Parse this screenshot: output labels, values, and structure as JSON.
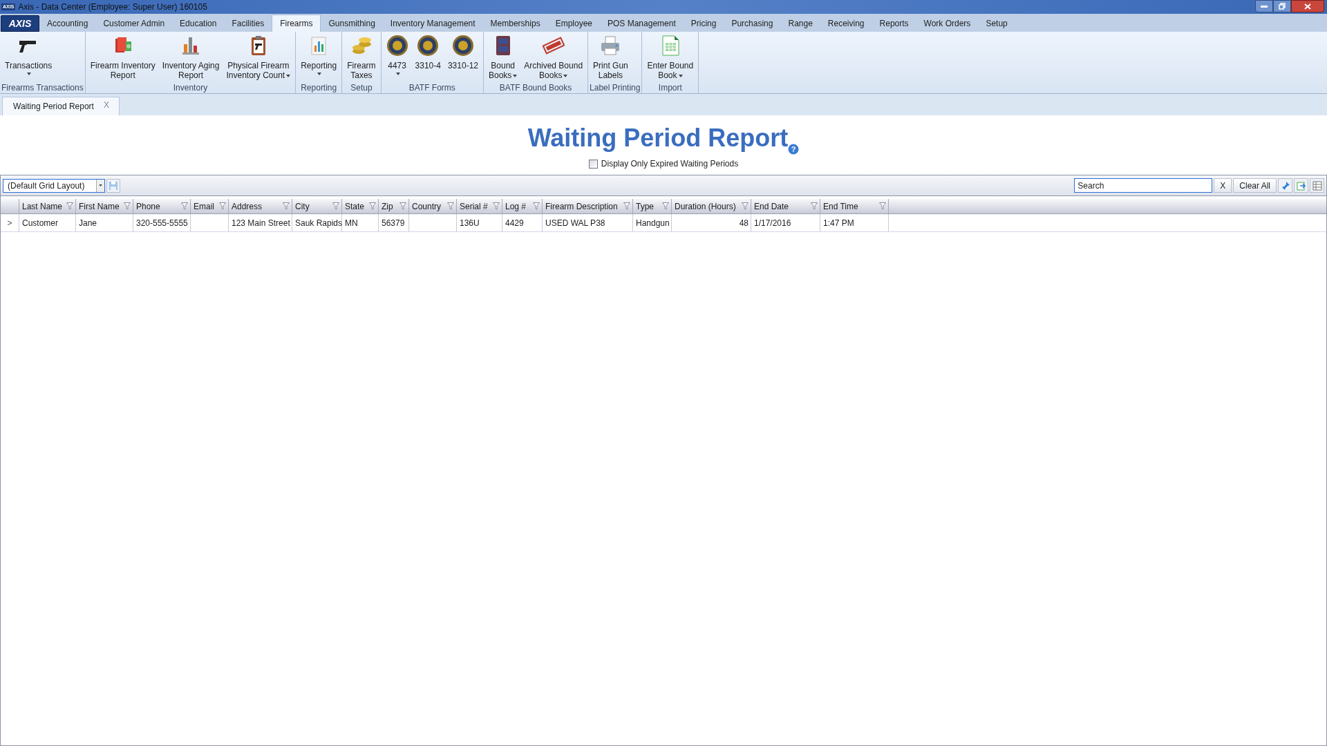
{
  "window": {
    "logo": "AXIS",
    "title": "Axis - Data Center  (Employee: Super User) 160105"
  },
  "menu_logo": "AXIS",
  "menu_tabs": [
    {
      "label": "Accounting",
      "selected": false
    },
    {
      "label": "Customer Admin",
      "selected": false
    },
    {
      "label": "Education",
      "selected": false
    },
    {
      "label": "Facilities",
      "selected": false
    },
    {
      "label": "Firearms",
      "selected": true
    },
    {
      "label": "Gunsmithing",
      "selected": false
    },
    {
      "label": "Inventory Management",
      "selected": false
    },
    {
      "label": "Memberships",
      "selected": false
    },
    {
      "label": "Employee",
      "selected": false
    },
    {
      "label": "POS Management",
      "selected": false
    },
    {
      "label": "Pricing",
      "selected": false
    },
    {
      "label": "Purchasing",
      "selected": false
    },
    {
      "label": "Range",
      "selected": false
    },
    {
      "label": "Receiving",
      "selected": false
    },
    {
      "label": "Reports",
      "selected": false
    },
    {
      "label": "Work Orders",
      "selected": false
    },
    {
      "label": "Setup",
      "selected": false
    }
  ],
  "ribbon": {
    "groups": [
      {
        "label": "Firearms Transactions",
        "items": [
          {
            "kind": "pistol",
            "lines": [
              "Transactions"
            ],
            "dropdown": true
          }
        ]
      },
      {
        "label": "Inventory",
        "items": [
          {
            "kind": "money",
            "lines": [
              "Firearm Inventory",
              "Report"
            ],
            "dropdown": false
          },
          {
            "kind": "bars",
            "lines": [
              "Inventory Aging",
              "Report"
            ],
            "dropdown": false
          },
          {
            "kind": "clipboard",
            "lines": [
              "Physical Firearm",
              "Inventory Count"
            ],
            "dropdown": true
          }
        ]
      },
      {
        "label": "Reporting",
        "items": [
          {
            "kind": "report",
            "lines": [
              "Reporting"
            ],
            "dropdown": true
          }
        ]
      },
      {
        "label": "Setup",
        "items": [
          {
            "kind": "coins",
            "lines": [
              "Firearm",
              "Taxes"
            ],
            "dropdown": false
          }
        ]
      },
      {
        "label": "BATF Forms",
        "items": [
          {
            "kind": "seal",
            "lines": [
              "4473"
            ],
            "dropdown": true
          },
          {
            "kind": "seal",
            "lines": [
              "3310-4"
            ],
            "dropdown": false
          },
          {
            "kind": "seal",
            "lines": [
              "3310-12"
            ],
            "dropdown": false
          }
        ]
      },
      {
        "label": "BATF Bound Books",
        "items": [
          {
            "kind": "book",
            "lines": [
              "Bound",
              "Books"
            ],
            "dropdown": true
          },
          {
            "kind": "stamp",
            "lines": [
              "Archived Bound",
              "Books"
            ],
            "dropdown": true
          }
        ]
      },
      {
        "label": "Label Printing",
        "items": [
          {
            "kind": "printer",
            "lines": [
              "Print Gun",
              "Labels"
            ],
            "dropdown": false
          }
        ]
      },
      {
        "label": "Import",
        "items": [
          {
            "kind": "sheet",
            "lines": [
              "Enter Bound",
              "Book"
            ],
            "dropdown": true
          }
        ]
      }
    ]
  },
  "doc_tabs": [
    {
      "label": "Waiting Period Report",
      "close": "X",
      "selected": true
    }
  ],
  "report": {
    "title": "Waiting Period Report",
    "help": "?",
    "option": {
      "label": "Display Only Expired Waiting Periods",
      "checked": false
    }
  },
  "toolbar": {
    "layout": "(Default Grid Layout)",
    "search": {
      "value": "Search"
    },
    "clear_search": "X",
    "clear_all": "Clear All"
  },
  "table": {
    "columns": [
      "Last Name",
      "First Name",
      "Phone",
      "Email",
      "Address",
      "City",
      "State",
      "Zip",
      "Country",
      "Serial #",
      "Log #",
      "Firearm Description",
      "Type",
      "Duration (Hours)",
      "End Date",
      "End Time"
    ],
    "rows": [
      {
        "indicator": ">",
        "cells": [
          "Customer",
          "Jane",
          "320-555-5555",
          "",
          "123 Main Street",
          "Sauk Rapids",
          "MN",
          "56379",
          "",
          "136U",
          "4429",
          "USED WAL P38",
          "Handgun",
          "48",
          "1/17/2016",
          "1:47 PM"
        ]
      }
    ]
  }
}
